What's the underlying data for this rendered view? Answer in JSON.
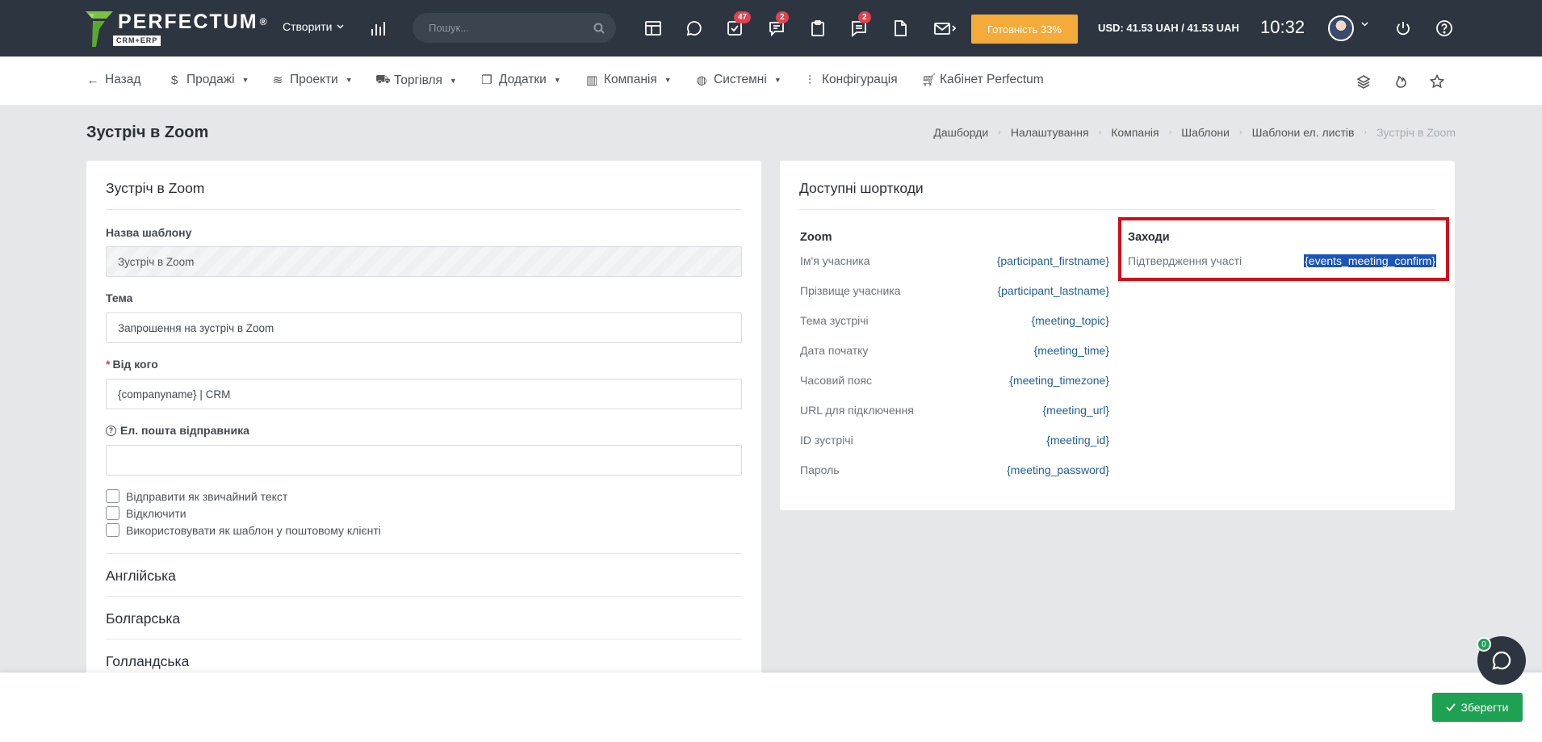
{
  "topbar": {
    "logo_text": "PERFECTUM",
    "logo_reg": "®",
    "logo_sub": "CRM+ERP",
    "create_label": "Створити",
    "search_placeholder": "Пошук...",
    "badges": {
      "tasks": "47",
      "messages": "2",
      "comments": "2"
    },
    "readiness_label": "Готовність 33%",
    "currency": "USD: 41.53 UAH / 41.53 UAH",
    "time": "10:32"
  },
  "nav": {
    "back": "Назад",
    "sales": "Продажі",
    "projects": "Проекти",
    "trade": "Торгівля",
    "addons": "Додатки",
    "company": "Компанія",
    "system": "Системні",
    "config": "Конфігурація",
    "cabinet": "Кабінет Perfectum"
  },
  "page": {
    "title": "Зустріч в Zoom",
    "breadcrumb": [
      "Дашборди",
      "Налаштування",
      "Компанія",
      "Шаблони",
      "Шаблони ел. листів",
      "Зустріч в Zoom"
    ]
  },
  "form": {
    "card_title": "Зустріч в Zoom",
    "template_name_label": "Назва шаблону",
    "template_name_value": "Зустріч в Zoom",
    "subject_label": "Тема",
    "subject_value": "Запрошення на зустріч в Zoom",
    "from_label": "Від кого",
    "from_value": "{companyname} | CRM",
    "sender_email_label": "Ел. пошта відправника",
    "sender_email_value": "",
    "checkboxes": [
      "Відправити як звичайний текст",
      "Відключити",
      "Використовувати як шаблон у поштовому клієнті"
    ],
    "languages": [
      "Англійська",
      "Болгарська",
      "Голландська"
    ]
  },
  "shortcodes": {
    "card_title": "Доступні шорткоди",
    "zoom": {
      "heading": "Zoom",
      "items": [
        {
          "name": "Ім'я учасника",
          "code": "{participant_firstname}"
        },
        {
          "name": "Прізвище учасника",
          "code": "{participant_lastname}"
        },
        {
          "name": "Тема зустрічі",
          "code": "{meeting_topic}"
        },
        {
          "name": "Дата початку",
          "code": "{meeting_time}"
        },
        {
          "name": "Часовий пояс",
          "code": "{meeting_timezone}"
        },
        {
          "name": "URL для підключення",
          "code": "{meeting_url}"
        },
        {
          "name": "ID зустрічі",
          "code": "{meeting_id}"
        },
        {
          "name": "Пароль",
          "code": "{meeting_password}"
        }
      ]
    },
    "events": {
      "heading": "Заходи",
      "items": [
        {
          "name": "Підтвердження участі",
          "code": "{events_meeting_confirm}"
        }
      ]
    }
  },
  "footer": {
    "save_label": "Зберегти",
    "chat_badge": "0"
  },
  "colors": {
    "topbar": "#2d3640",
    "accent_orange": "#f4ab3a",
    "save_green": "#1fa154",
    "highlight_red": "#d30e17",
    "selection_blue": "#1c54b8"
  }
}
